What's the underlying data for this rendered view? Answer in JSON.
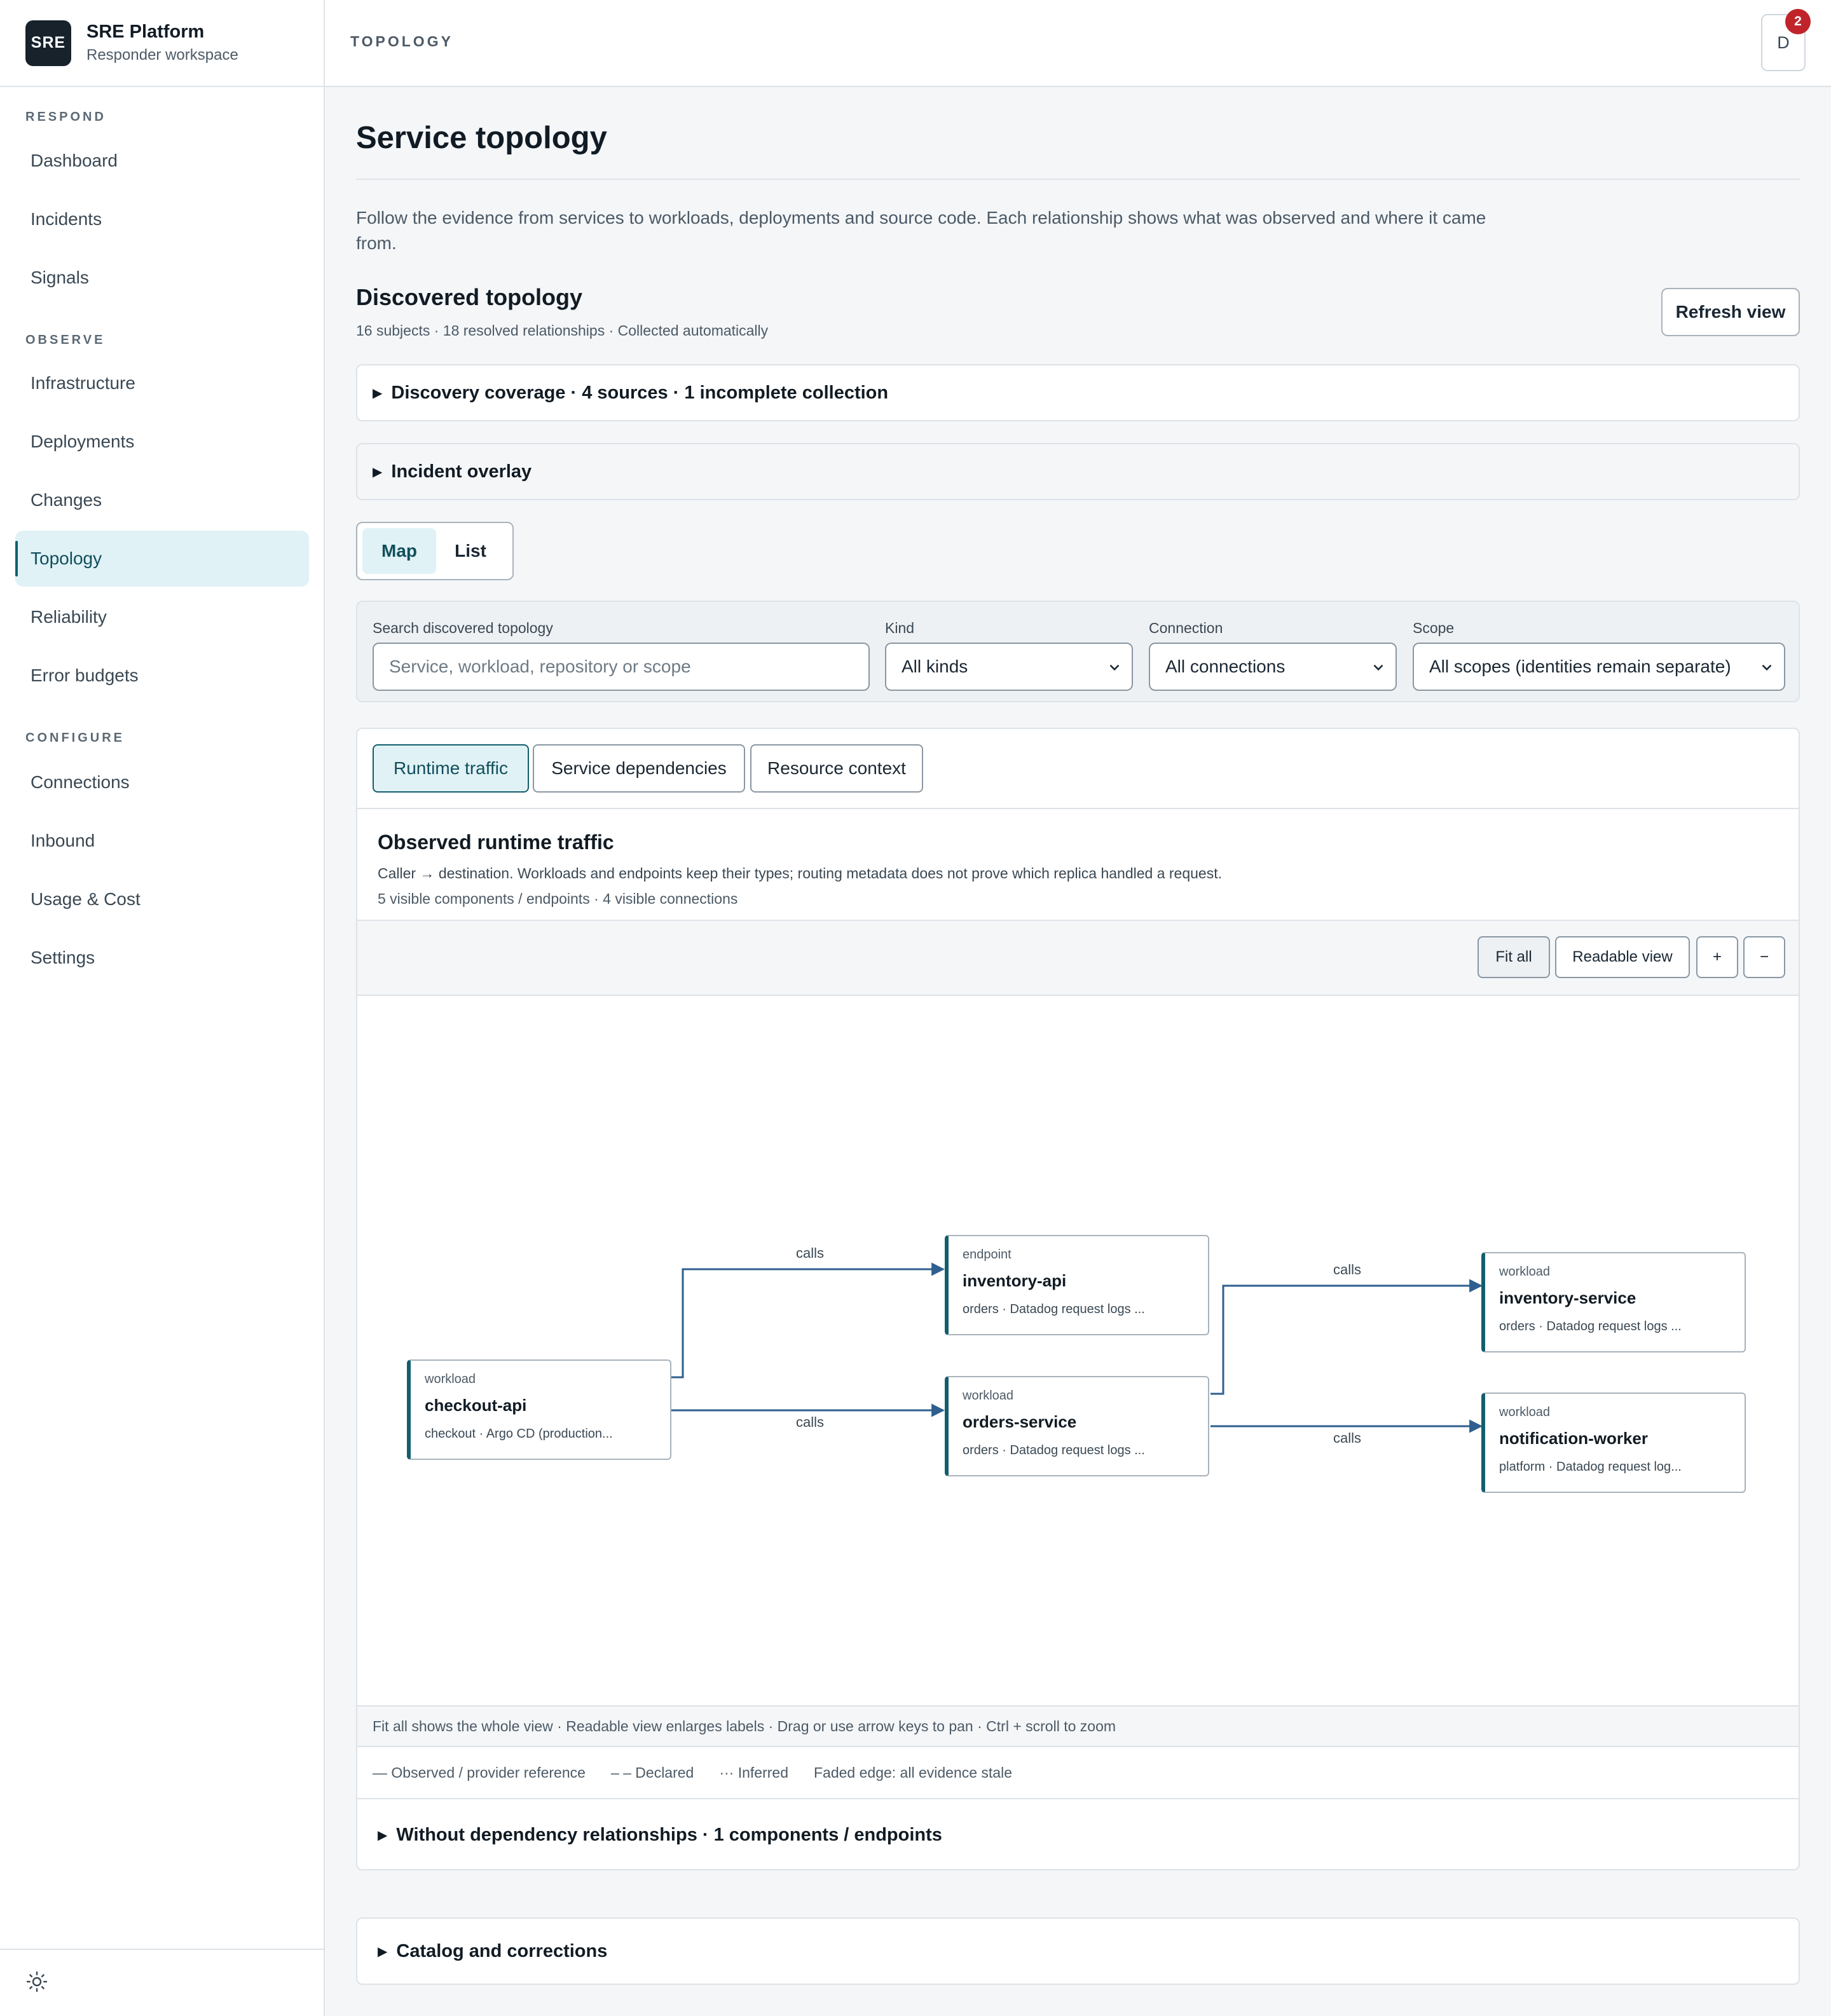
{
  "brand": {
    "logo": "SRE",
    "title": "SRE Platform",
    "subtitle": "Responder workspace"
  },
  "nav": {
    "sections": [
      {
        "label": "RESPOND"
      },
      {
        "label": "OBSERVE"
      },
      {
        "label": "CONFIGURE"
      }
    ],
    "items": [
      {
        "label": "Dashboard"
      },
      {
        "label": "Incidents"
      },
      {
        "label": "Signals"
      },
      {
        "label": "Infrastructure"
      },
      {
        "label": "Deployments"
      },
      {
        "label": "Changes"
      },
      {
        "label": "Topology",
        "active": true
      },
      {
        "label": "Reliability"
      },
      {
        "label": "Error budgets"
      },
      {
        "label": "Connections"
      },
      {
        "label": "Inbound"
      },
      {
        "label": "Usage & Cost"
      },
      {
        "label": "Settings"
      }
    ],
    "theme_icon": "sun-icon"
  },
  "header": {
    "breadcrumb": "TOPOLOGY",
    "avatar": "D",
    "notifications": "2"
  },
  "page": {
    "title": "Service topology",
    "intro": "Follow the evidence from services to workloads, deployments and source code. Each relationship shows what was observed and where it came from.",
    "section_title": "Discovered topology",
    "section_meta": "16 subjects · 18 resolved relationships · Collected automatically",
    "refresh_label": "Refresh view",
    "coverage": "Discovery coverage · 4 sources · 1 incomplete collection",
    "overlay": "Incident overlay",
    "views": [
      "Map",
      "List"
    ],
    "catalog": "Catalog and corrections"
  },
  "filters": {
    "search_label": "Search discovered topology",
    "search_placeholder": "Service, workload, repository or scope",
    "kind_label": "Kind",
    "kind_value": "All kinds",
    "connection_label": "Connection",
    "connection_value": "All connections",
    "scope_label": "Scope",
    "scope_value": "All scopes (identities remain separate)"
  },
  "graph": {
    "tabs": [
      "Runtime traffic",
      "Service dependencies",
      "Resource context"
    ],
    "title": "Observed runtime traffic",
    "subtitle": "Caller → destination. Workloads and endpoints keep their types; routing metadata does not prove which replica handled a request.",
    "meta": "5 visible components / endpoints · 4 visible connections",
    "toolbar": [
      "Fit all",
      "Readable view",
      "+",
      "−"
    ],
    "nodes": [
      {
        "kind": "workload",
        "name": "checkout-api",
        "desc": "checkout · Argo CD (production..."
      },
      {
        "kind": "endpoint",
        "name": "inventory-api",
        "desc": "orders · Datadog request logs ..."
      },
      {
        "kind": "workload",
        "name": "orders-service",
        "desc": "orders · Datadog request logs ..."
      },
      {
        "kind": "workload",
        "name": "inventory-service",
        "desc": "orders · Datadog request logs ..."
      },
      {
        "kind": "workload",
        "name": "notification-worker",
        "desc": "platform · Datadog request log..."
      }
    ],
    "edges": [
      {
        "from": "checkout-api",
        "to": "inventory-api",
        "label": "calls"
      },
      {
        "from": "checkout-api",
        "to": "orders-service",
        "label": "calls"
      },
      {
        "from": "orders-service",
        "to": "inventory-service",
        "label": "calls"
      },
      {
        "from": "orders-service",
        "to": "notification-worker",
        "label": "calls"
      }
    ],
    "hint": "Fit all shows the whole view · Readable view enlarges labels · Drag or use arrow keys to pan · Ctrl + scroll to zoom",
    "legend": [
      "— Observed / provider reference",
      "– – Declared",
      "··· Inferred",
      "Faded edge: all evidence stale"
    ],
    "without": "Without dependency relationships · 1 components / endpoints"
  },
  "colors": {
    "accent": "#135e6d",
    "edge": "#2f5f8f",
    "badge": "#c0242a"
  }
}
